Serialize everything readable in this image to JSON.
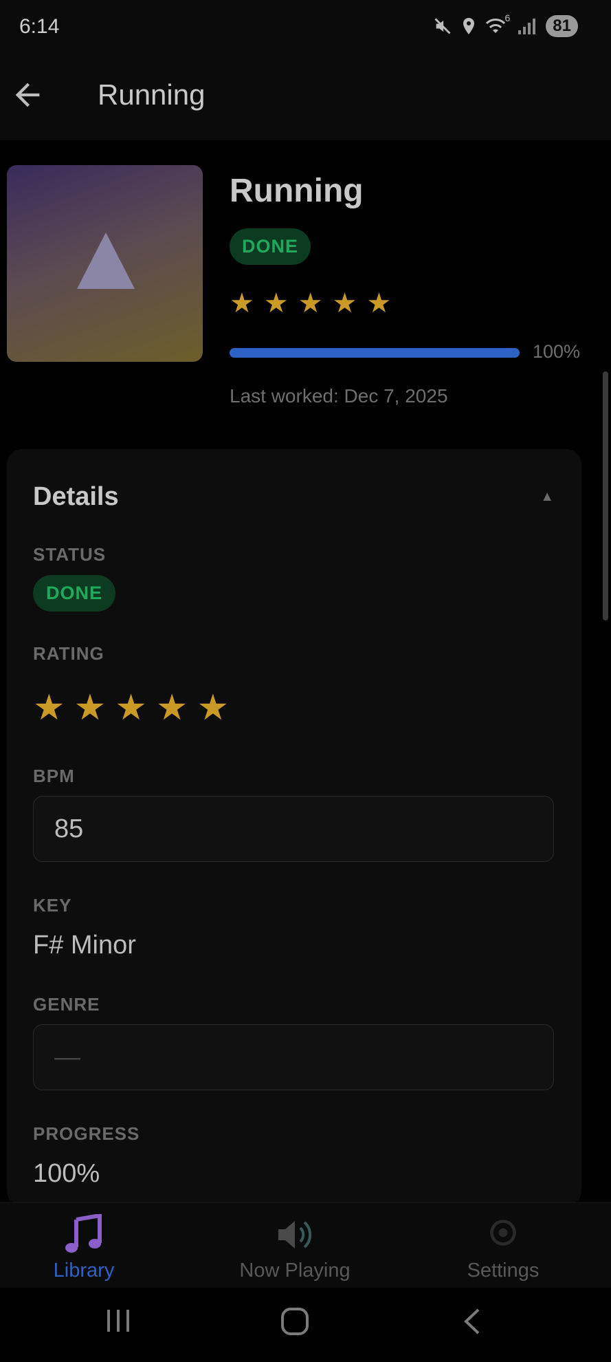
{
  "status_bar": {
    "time": "6:14",
    "battery": "81",
    "wifi_label": "6"
  },
  "app_bar": {
    "title": "Running"
  },
  "header": {
    "title": "Running",
    "status_badge": "DONE",
    "rating": 5,
    "progress_percent": 100,
    "progress_label": "100%",
    "last_worked": "Last worked: Dec 7, 2025"
  },
  "details": {
    "section_title": "Details",
    "status": {
      "label": "STATUS",
      "value": "DONE"
    },
    "rating": {
      "label": "RATING",
      "value": 5
    },
    "bpm": {
      "label": "BPM",
      "value": "85"
    },
    "key": {
      "label": "KEY",
      "value": "F# Minor"
    },
    "genre": {
      "label": "GENRE",
      "value": "—"
    },
    "progress": {
      "label": "PROGRESS",
      "value": "100%"
    }
  },
  "bottom_nav": {
    "items": [
      {
        "label": "Library",
        "icon": "music-note-icon"
      },
      {
        "label": "Now Playing",
        "icon": "speaker-icon"
      },
      {
        "label": "Settings",
        "icon": "gear-icon"
      }
    ]
  },
  "colors": {
    "accent": "#2e61c4",
    "done_text": "#1faa5b",
    "done_bg": "#0c3b22",
    "star": "#c99a26"
  }
}
